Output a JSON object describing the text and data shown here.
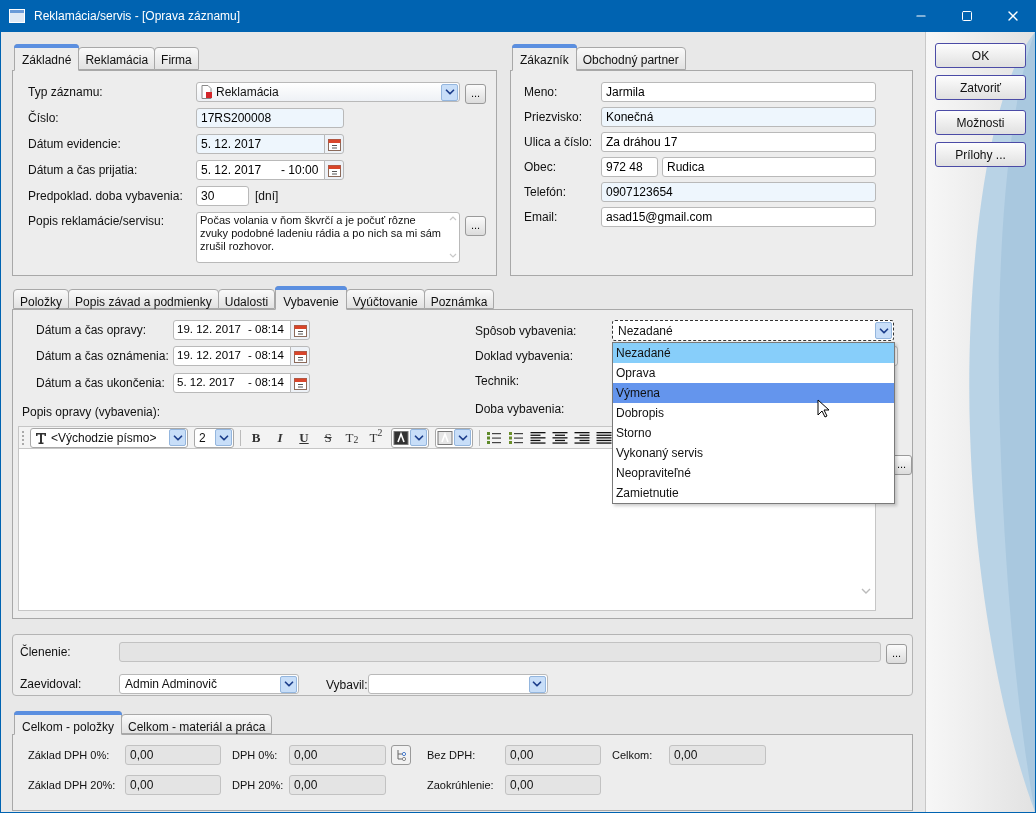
{
  "window": {
    "title": "Reklamácia/servis - [Oprava záznamu]"
  },
  "side_buttons": [
    {
      "label": "OK"
    },
    {
      "label": "Zatvoriť"
    },
    {
      "label": "Možnosti"
    },
    {
      "label": "Prílohy ..."
    }
  ],
  "record_tabs": [
    {
      "label": "Základné",
      "selected": true
    },
    {
      "label": "Reklamácia",
      "selected": false
    },
    {
      "label": "Firma",
      "selected": false
    }
  ],
  "record_fields": [
    {
      "kind": "combo",
      "label": "Typ záznamu:",
      "value": "Reklamácia",
      "button": "..."
    },
    {
      "kind": "text",
      "label": "Číslo:",
      "value": "17RS200008",
      "readonly": true
    },
    {
      "kind": "date",
      "label": "Dátum evidencie:",
      "date": "5. 12. 2017",
      "readonly": true
    },
    {
      "kind": "date",
      "label": "Dátum a čas prijatia:",
      "date": "5. 12. 2017",
      "time": "- 10:00",
      "readonly": false
    },
    {
      "kind": "days",
      "label": "Predpoklad. doba vybavenia:",
      "value": "30",
      "unit": "[dní]",
      "readonly": false
    },
    {
      "kind": "memo",
      "label": "Popis reklamácie/servisu:",
      "value": "Počas volania v ňom škvrčí a je počuť rôzne zvuky podobné ladeniu rádia a po nich sa mi sám zrušil rozhovor.",
      "button": "..."
    }
  ],
  "customer_tabs": [
    {
      "label": "Zákazník",
      "selected": true
    },
    {
      "label": "Obchodný partner",
      "selected": false
    }
  ],
  "customer_fields": [
    {
      "kind": "text",
      "label": "Meno:",
      "value": "Jarmila",
      "readonly": false
    },
    {
      "kind": "text",
      "label": "Priezvisko:",
      "value": "Konečná",
      "readonly": true
    },
    {
      "kind": "text",
      "label": "Ulica a číslo:",
      "value": "Za dráhou 17",
      "readonly": false
    },
    {
      "kind": "postal",
      "label": "Obec:",
      "zip": "972 48",
      "value": "Rudica",
      "readonly": false
    },
    {
      "kind": "text",
      "label": "Telefón:",
      "value": "0907123654",
      "readonly": true
    },
    {
      "kind": "text",
      "label": "Email:",
      "value": "asad15@gmail.com",
      "readonly": false
    }
  ],
  "detail_tabs": [
    {
      "label": "Položky",
      "selected": false
    },
    {
      "label": "Popis závad a podmienky",
      "selected": false
    },
    {
      "label": "Udalosti",
      "selected": false
    },
    {
      "label": "Vybavenie",
      "selected": true
    },
    {
      "label": "Vyúčtovanie",
      "selected": false
    },
    {
      "label": "Poznámka",
      "selected": false
    }
  ],
  "repair": {
    "dates": [
      {
        "label": "Dátum a čas opravy:",
        "date": "19. 12. 2017",
        "time": "- 08:14"
      },
      {
        "label": "Dátum a čas oznámenia:",
        "date": "19. 12. 2017",
        "time": "- 08:14"
      },
      {
        "label": "Dátum a čas ukončenia:",
        "date": "5. 12. 2017",
        "time": "- 08:14"
      }
    ],
    "method": {
      "label": "Spôsob vybavenia:",
      "value": "Nezadané",
      "expanded": true,
      "options": [
        {
          "label": "Nezadané",
          "selected": true,
          "hovered": false
        },
        {
          "label": "Oprava",
          "selected": false,
          "hovered": false
        },
        {
          "label": "Výmena",
          "selected": false,
          "hovered": true
        },
        {
          "label": "Dobropis",
          "selected": false,
          "hovered": false
        },
        {
          "label": "Storno",
          "selected": false,
          "hovered": false
        },
        {
          "label": "Vykonaný servis",
          "selected": false,
          "hovered": false
        },
        {
          "label": "Neopraviteľné",
          "selected": false,
          "hovered": false
        },
        {
          "label": "Zamietnutie",
          "selected": false,
          "hovered": false
        }
      ]
    },
    "doc_label": "Doklad vybavenia:",
    "technician_label": "Technik:",
    "duration_label": "Doba vybavenia:",
    "description_label": "Popis opravy (vybavenia):",
    "toolbar": {
      "font": "<Východzie písmo>",
      "size": "2",
      "format_buttons": [
        {
          "kind": "bold",
          "label": "B"
        },
        {
          "kind": "italic",
          "label": "I"
        },
        {
          "kind": "underline",
          "label": "U"
        },
        {
          "kind": "strike",
          "label": "S"
        },
        {
          "kind": "plain",
          "label": "T$_{2}$"
        },
        {
          "kind": "plain",
          "label": "T$^{2}$"
        }
      ]
    },
    "editor_button": "..."
  },
  "classification": {
    "label": "Členenie:",
    "button": "..."
  },
  "registered_by": {
    "label": "Zaevidoval:",
    "value": "Admin Adminovič"
  },
  "handled_by": {
    "label": "Vybavil:"
  },
  "totals_tabs": [
    {
      "label": "Celkom - položky",
      "selected": true
    },
    {
      "label": "Celkom - materiál a práca",
      "selected": false
    }
  ],
  "totals_rows": [
    [
      {
        "label": "Základ DPH 0%:",
        "value": "0,00"
      },
      {
        "label": "DPH 0%:",
        "value": "0,00",
        "has_button": true
      },
      {
        "label": "Bez DPH:",
        "value": "0,00"
      },
      {
        "label": "Celkom:",
        "value": "0,00"
      }
    ],
    [
      {
        "label": "Základ DPH 20%:",
        "value": "0,00"
      },
      {
        "label": "DPH 20%:",
        "value": "0,00"
      },
      {
        "label": "Zaokrúhlenie:",
        "value": "0,00"
      }
    ]
  ]
}
